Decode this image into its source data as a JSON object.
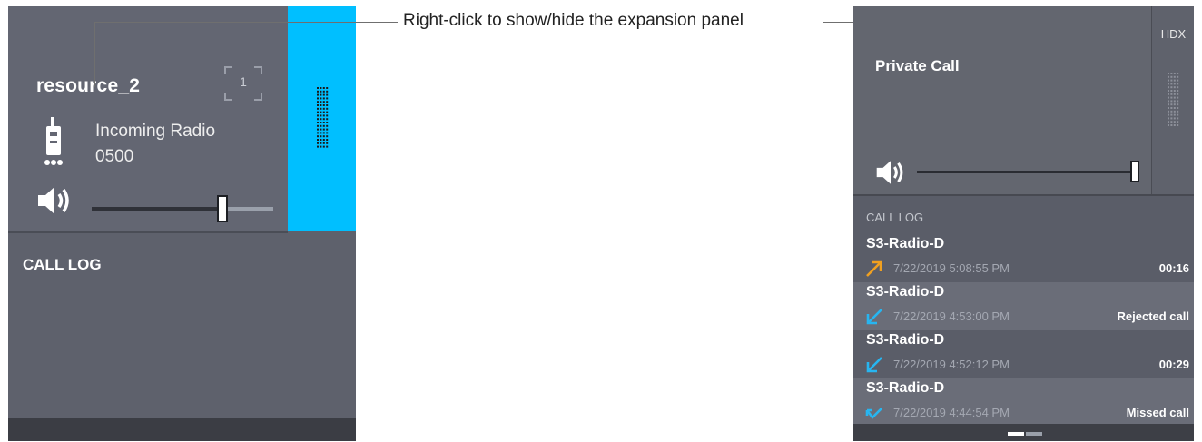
{
  "callout": {
    "text": "Right-click to show/hide the expansion panel"
  },
  "left_tile": {
    "resource_name": "resource_2",
    "slot_number": "1",
    "incoming_line1": "Incoming Radio",
    "incoming_line2": "0500",
    "volume_level": 0.72,
    "strip_color": "#00bfff",
    "radio_icon": "radio-icon",
    "speaker_icon": "speaker-icon",
    "call_log_title": "CALL LOG"
  },
  "right_tile": {
    "title": "Private Call",
    "side_label": "HDX",
    "volume_level": 1.0,
    "speaker_icon": "speaker-icon",
    "call_log_title": "CALL LOG",
    "entries": [
      {
        "name": "S3-Radio-D",
        "date": "7/22/2019 5:08:55 PM",
        "status": "00:16",
        "arrow": "outgoing-arrow-icon",
        "arrow_color": "#f0a020"
      },
      {
        "name": "S3-Radio-D",
        "date": "7/22/2019 4:53:00 PM",
        "status": "Rejected call",
        "arrow": "incoming-arrow-icon",
        "arrow_color": "#27b5f0"
      },
      {
        "name": "S3-Radio-D",
        "date": "7/22/2019 4:52:12 PM",
        "status": "00:29",
        "arrow": "incoming-arrow-icon",
        "arrow_color": "#27b5f0"
      },
      {
        "name": "S3-Radio-D",
        "date": "7/22/2019 4:44:54 PM",
        "status": "Missed call",
        "arrow": "missed-arrow-icon",
        "arrow_color": "#27b5f0"
      }
    ],
    "pages": 2,
    "active_page": 1
  }
}
